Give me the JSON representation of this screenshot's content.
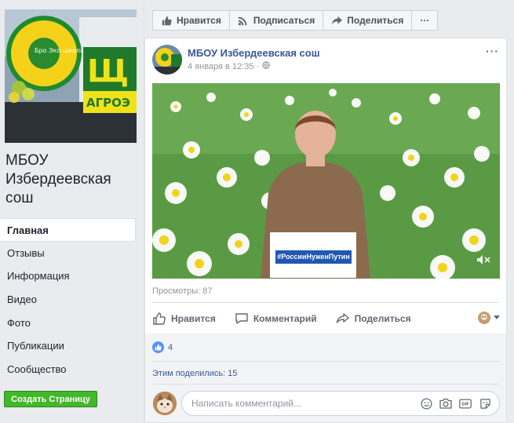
{
  "sidebar": {
    "cover_logo_text": "Бро Эко школа",
    "cover_sign_letter": "Щ",
    "cover_sign_text": "АГРОЭ",
    "page_name": "МБОУ Избердеевская сош",
    "nav": [
      {
        "label": "Главная",
        "active": true
      },
      {
        "label": "Отзывы"
      },
      {
        "label": "Информация"
      },
      {
        "label": "Видео"
      },
      {
        "label": "Фото"
      },
      {
        "label": "Публикации"
      },
      {
        "label": "Сообщество"
      }
    ],
    "create_page_label": "Создать Страницу"
  },
  "top_actions": {
    "like": "Нравится",
    "subscribe": "Подписаться",
    "share": "Поделиться",
    "more": "···"
  },
  "post": {
    "author": "МБОУ Избердеевская сош",
    "date": "4 января в 12:35 ·",
    "more": "···",
    "video_hashtag": "#РоссииНуженПутин",
    "views": "Просмотры: 87",
    "actions": {
      "like": "Нравится",
      "comment": "Комментарий",
      "share": "Поделиться"
    },
    "reactions_count": "4",
    "shares_text": "Этим поделились: 15",
    "comment_placeholder": "Написать комментарий..."
  },
  "colors": {
    "link_blue": "#385898",
    "like_blue": "#5890ff",
    "create_green": "#42b72a",
    "video_green": "#4e8c3a"
  }
}
